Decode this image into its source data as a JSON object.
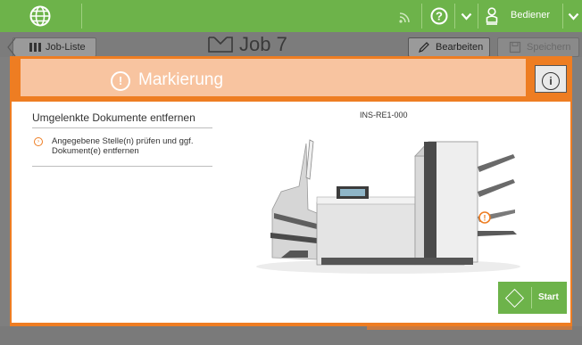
{
  "topbar": {
    "globe_icon": "globe-icon",
    "feed_icon": "feed-icon",
    "help_icon": "help-icon",
    "chevron_icon": "chevron-down-icon",
    "user_icon": "user-icon",
    "user_label": "Bediener",
    "color": "#6db34a"
  },
  "background_screen": {
    "back_label": "Job-Liste",
    "job_title": "Job 7",
    "edit_label": "Bearbeiten",
    "save_label": "Speichern"
  },
  "modal": {
    "title": "Markierung",
    "close_symbol": "✕",
    "warning_symbol": "!",
    "info_symbol": "i",
    "accent": "#ee7d22",
    "section_title": "Umgelenkte Dokumente entfernen",
    "step_text": "Angegebene Stelle(n) prüfen und ggf. Dokument(e) entfernen",
    "device_code": "INS-RE1-000",
    "marker_symbol": "!",
    "start_label": "Start"
  }
}
